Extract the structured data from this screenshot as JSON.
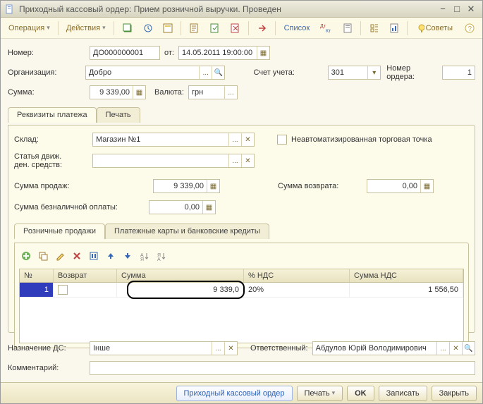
{
  "window": {
    "title": "Приходный кассовый ордер: Прием розничной выручки. Проведен"
  },
  "menu": {
    "operation": "Операция",
    "actions": "Действия",
    "list": "Список",
    "tips": "Советы"
  },
  "fields": {
    "number_label": "Номер:",
    "number_value": "ДО000000001",
    "ot": "от:",
    "date": "14.05.2011 19:00:00",
    "org_label": "Организация:",
    "org_value": "Добро",
    "account_label": "Счет учета:",
    "account_value": "301",
    "ordno_label": "Номер ордера:",
    "ordno_value": "1",
    "sum_label": "Сумма:",
    "sum_value": "9 339,00",
    "currency_label": "Валюта:",
    "currency_value": "грн"
  },
  "tabs1": {
    "active": "Реквизиты платежа",
    "inactive": "Печать"
  },
  "panel1": {
    "sklad_label": "Склад:",
    "sklad_value": "Магазин №1",
    "stat_label": "Статья движ.\nден. средств:",
    "stat_value": "",
    "nonauto_label": "Неавтоматизированная торговая точка",
    "sum_sales_label": "Сумма продаж:",
    "sum_sales_value": "9 339,00",
    "sum_ret_label": "Сумма возврата:",
    "sum_ret_value": "0,00",
    "sum_cashless_label": "Сумма безналичной оплаты:",
    "sum_cashless_value": "0,00"
  },
  "tabs2": {
    "active": "Розничные продажи",
    "inactive": "Платежные карты и банковские кредиты"
  },
  "grid": {
    "cols": [
      "№",
      "Возврат",
      "Сумма",
      "% НДС",
      "Сумма НДС"
    ],
    "row": {
      "n": "1",
      "vozvrat": "",
      "summa": "9 339,0",
      "nds_pct": "20%",
      "nds_sum": "1 556,50"
    }
  },
  "bottom": {
    "nazn_label": "Назначение ДС:",
    "nazn_value": "Інше",
    "resp_label": "Ответственный:",
    "resp_value": "Абдулов Юрій Володимирович",
    "comm_label": "Комментарий:",
    "comm_value": ""
  },
  "footer": {
    "pko": "Приходный кассовый ордер",
    "print": "Печать",
    "ok": "OK",
    "save": "Записать",
    "close": "Закрыть"
  }
}
